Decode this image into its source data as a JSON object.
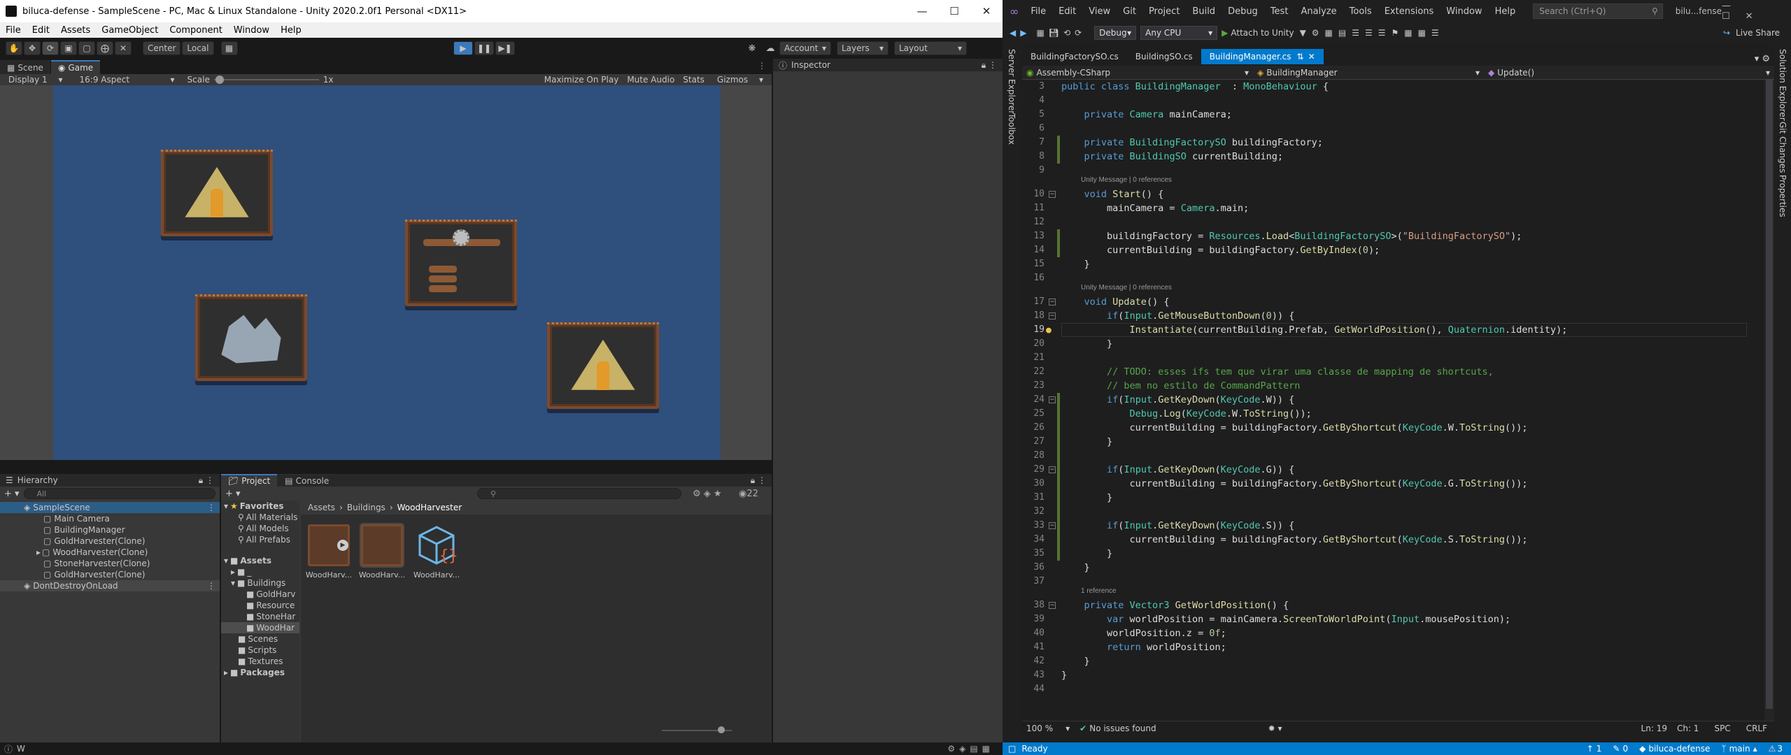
{
  "unity": {
    "title": "biluca-defense - SampleScene - PC, Mac & Linux Standalone - Unity 2020.2.0f1 Personal <DX11>",
    "menu": [
      "File",
      "Edit",
      "Assets",
      "GameObject",
      "Component",
      "Window",
      "Help"
    ],
    "toolbar": {
      "center": "Center",
      "local": "Local",
      "account": "Account",
      "layers": "Layers",
      "layout": "Layout"
    },
    "tabs": {
      "scene": "Scene",
      "game": "Game",
      "inspector": "Inspector",
      "hierarchy": "Hierarchy",
      "project": "Project",
      "console": "Console"
    },
    "game_bar": {
      "display": "Display 1",
      "aspect": "16:9 Aspect",
      "scale_label": "Scale",
      "scale_value": "1x",
      "maximize": "Maximize On Play",
      "mute": "Mute Audio",
      "stats": "Stats",
      "gizmos": "Gizmos"
    },
    "hierarchy": {
      "search": "All",
      "scene": "SampleScene",
      "items": [
        "Main Camera",
        "BuildingManager",
        "GoldHarvester(Clone)",
        "WoodHarvester(Clone)",
        "StoneHarvester(Clone)",
        "GoldHarvester(Clone)"
      ],
      "dont_destroy": "DontDestroyOnLoad"
    },
    "project": {
      "favorites": "Favorites",
      "fav_items": [
        "All Materials",
        "All Models",
        "All Prefabs"
      ],
      "assets": "Assets",
      "tree": [
        "_",
        "Buildings",
        "GoldHarv",
        "Resource",
        "StoneHar",
        "WoodHar",
        "Scenes",
        "Scripts",
        "Textures"
      ],
      "packages": "Packages",
      "breadcrumb": [
        "Assets",
        "Buildings",
        "WoodHarvester"
      ],
      "count": "22",
      "files": [
        "WoodHarv...",
        "WoodHarv...",
        "WoodHarv..."
      ]
    },
    "status_text": "W"
  },
  "vs": {
    "menu": [
      "File",
      "Edit",
      "View",
      "Git",
      "Project",
      "Build",
      "Debug",
      "Test",
      "Analyze",
      "Tools",
      "Extensions",
      "Window",
      "Help"
    ],
    "search": "Search (Ctrl+Q)",
    "solution": "bilu...fense",
    "live_share": "Live Share",
    "toolbar": {
      "config": "Debug",
      "platform": "Any CPU",
      "attach": "Attach to Unity"
    },
    "side_left": [
      "Server Explorer",
      "Toolbox"
    ],
    "side_right": [
      "Solution Explorer",
      "Git Changes",
      "Properties"
    ],
    "tabs": [
      "BuildingFactorySO.cs",
      "BuildingSO.cs",
      "BuildingManager.cs"
    ],
    "nav": {
      "project": "Assembly-CSharp",
      "class": "BuildingManager",
      "member": "Update()"
    },
    "codelens": {
      "unity_msg": "Unity Message | 0 references",
      "one_ref": "1 reference"
    },
    "bottom": {
      "zoom": "100 %",
      "issues": "No issues found",
      "position": "Ln: 19",
      "col": "Ch: 1",
      "spc": "SPC",
      "crlf": "CRLF"
    },
    "status": {
      "ready": "Ready",
      "up": "1",
      "changes": "0",
      "repo": "biluca-defense",
      "branch": "main",
      "errors": "3"
    }
  }
}
